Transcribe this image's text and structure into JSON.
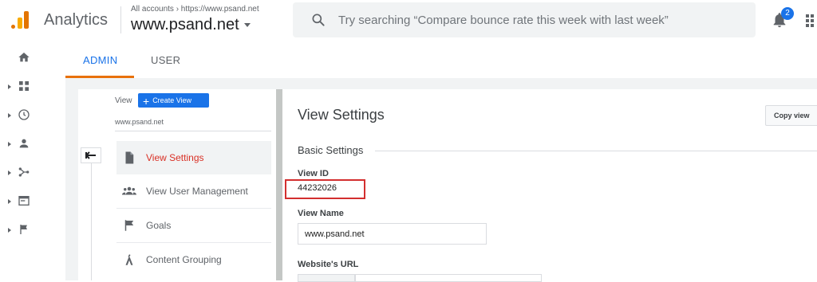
{
  "app": {
    "title": "Analytics"
  },
  "header": {
    "breadcrumb": "All accounts › https://www.psand.net",
    "property": "www.psand.net",
    "search_placeholder": "Try searching “Compare bounce rate this week with last week”",
    "notification_count": "2"
  },
  "tabs": {
    "admin": "ADMIN",
    "user": "USER"
  },
  "view_column": {
    "label": "View",
    "create_button": "Create View",
    "current_view": "www.psand.net",
    "items": [
      {
        "label": "View Settings",
        "icon": "document-icon",
        "active": true
      },
      {
        "label": "View User Management",
        "icon": "people-icon",
        "active": false
      },
      {
        "label": "Goals",
        "icon": "flag-icon",
        "active": false
      },
      {
        "label": "Content Grouping",
        "icon": "person-walk-icon",
        "active": false
      }
    ]
  },
  "settings": {
    "title": "View Settings",
    "copy_button": "Copy view",
    "section": "Basic Settings",
    "view_id_label": "View ID",
    "view_id": "44232026",
    "view_name_label": "View Name",
    "view_name": "www.psand.net",
    "website_url_label": "Website's URL"
  },
  "colors": {
    "accent": "#1a73e8",
    "active_menu": "#d93025",
    "tab_underline": "#e8710a",
    "highlight_box": "#d32f2f"
  }
}
